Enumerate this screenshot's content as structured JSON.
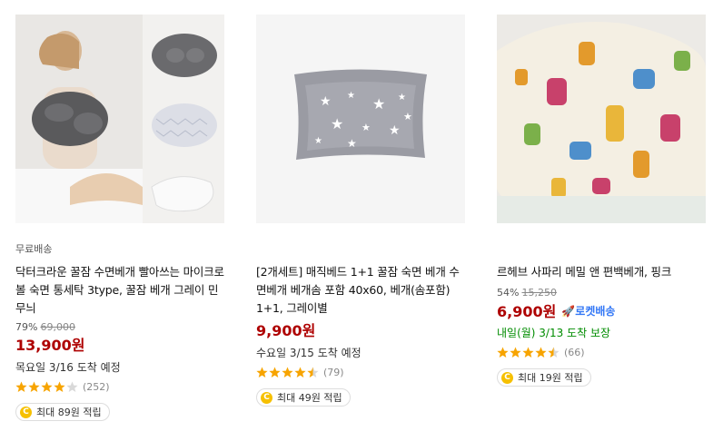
{
  "products": [
    {
      "badge": "무료배송",
      "title": "닥터크라운 꿀잠 수면베개 빨아쓰는 마이크로볼 숙면 통세탁 3type, 꿀잠 베개 그레이 민무늬",
      "discount": "79%",
      "original_price": "69,000",
      "price": "13,900원",
      "rocket": "",
      "delivery": "목요일 3/16 도착 예정",
      "rating": 4,
      "review_count": "(252)",
      "cashback": "최대 89원 적립"
    },
    {
      "badge": "",
      "title": "[2개세트] 매직베드 1+1 꿀잠 숙면 베개 수면베개 베개솜 포함 40x60, 베개(솜포함) 1+1, 그레이별",
      "discount": "",
      "original_price": "",
      "price": "9,900원",
      "rocket": "",
      "delivery": "수요일 3/15 도착 예정",
      "rating": 4.5,
      "review_count": "(79)",
      "cashback": "최대 49원 적립"
    },
    {
      "badge": "",
      "title": "르헤브 사파리 메밀 앤 편백베개, 핑크",
      "discount": "54%",
      "original_price": "15,250",
      "price": "6,900원",
      "rocket": "로켓배송",
      "delivery": "내일(월) 3/13 도착 보장",
      "rating": 4.5,
      "review_count": "(66)",
      "cashback": "최대 19원 적립"
    }
  ],
  "colors": {
    "price": "#ae0000",
    "star": "#f7a400",
    "rocket": "#3478f6",
    "guaranteed": "#008c00"
  }
}
